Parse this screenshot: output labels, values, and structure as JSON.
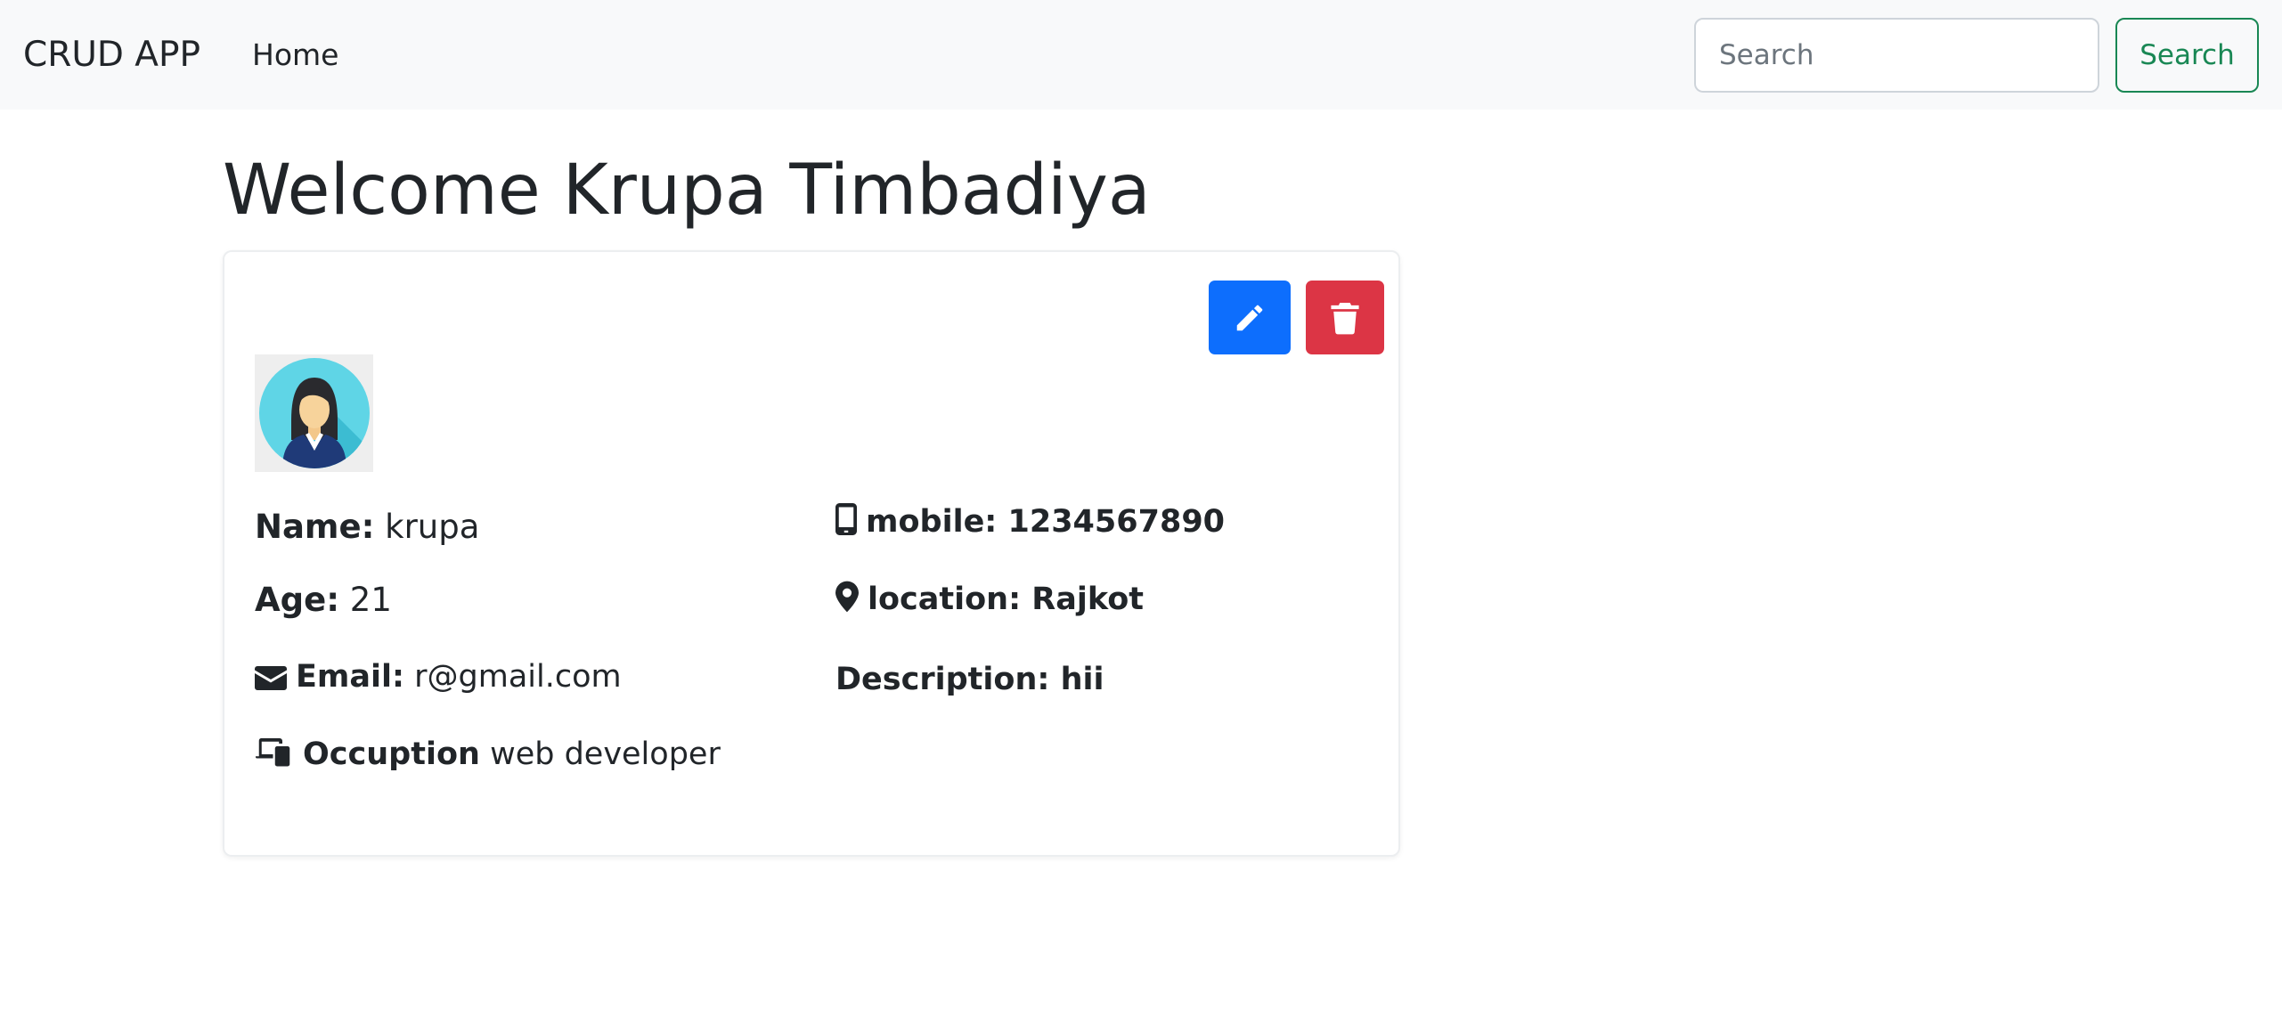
{
  "navbar": {
    "brand": "CRUD APP",
    "home_label": "Home",
    "search_placeholder": "Search",
    "search_button": "Search"
  },
  "page": {
    "welcome": "Welcome Krupa Timbadiya"
  },
  "card": {
    "edit_icon": "pencil-icon",
    "delete_icon": "trash-icon",
    "avatar_icon": "female-user-avatar",
    "name_label": "Name:",
    "name_value": "krupa",
    "age_label": "Age:",
    "age_value": "21",
    "email_label": "Email:",
    "email_value": "r@gmail.com",
    "occupation_label": "Occuption",
    "occupation_value": "web developer",
    "mobile_label": "mobile:",
    "mobile_value": "1234567890",
    "location_label": "location:",
    "location_value": "Rajkot",
    "description_label": "Description:",
    "description_value": "hii"
  },
  "colors": {
    "navbar_bg": "#f8f9fa",
    "success": "#198754",
    "primary": "#0d6efd",
    "danger": "#dc3545"
  }
}
